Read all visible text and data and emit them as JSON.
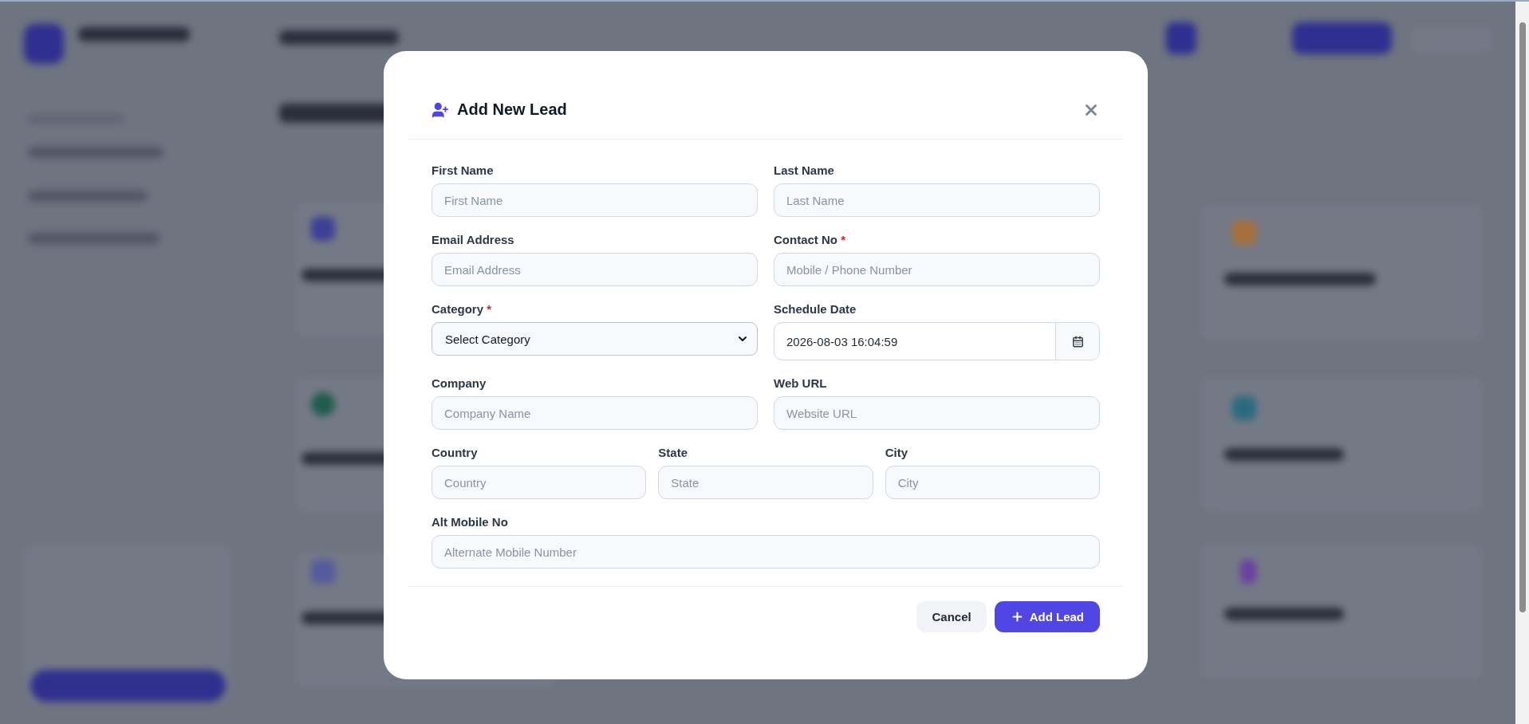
{
  "modal": {
    "title": "Add New Lead",
    "rows": [
      {
        "fields": [
          {
            "label": "First Name",
            "kind": "text",
            "placeholder": "First Name"
          },
          {
            "label": "Last Name",
            "kind": "text",
            "placeholder": "Last Name"
          }
        ]
      },
      {
        "fields": [
          {
            "label": "Email Address",
            "kind": "text",
            "placeholder": "Email Address"
          },
          {
            "label": "Contact No",
            "kind": "text",
            "required_mark": "*",
            "placeholder": "Mobile / Phone Number"
          }
        ]
      },
      {
        "fields": [
          {
            "label": "Category",
            "kind": "select",
            "required_mark": "*",
            "value": "Select Category"
          },
          {
            "label": "Schedule Date",
            "kind": "datetime",
            "value": "2026-08-03 16:04:59"
          }
        ]
      },
      {
        "fields": [
          {
            "label": "Company",
            "kind": "text",
            "placeholder": "Company Name"
          },
          {
            "label": "Web URL",
            "kind": "text",
            "placeholder": "Website URL"
          }
        ]
      },
      {
        "fields": [
          {
            "label": "Country",
            "kind": "text",
            "placeholder": "Country"
          },
          {
            "label": "State",
            "kind": "text",
            "placeholder": "State"
          },
          {
            "label": "City",
            "kind": "text",
            "placeholder": "City"
          }
        ]
      },
      {
        "fields": [
          {
            "label": "Alt Mobile No",
            "kind": "text",
            "placeholder": "Alternate Mobile Number"
          }
        ]
      }
    ],
    "buttons": [
      {
        "label": "Cancel",
        "kind": "secondary"
      },
      {
        "label": "Add Lead",
        "kind": "primary"
      }
    ]
  }
}
